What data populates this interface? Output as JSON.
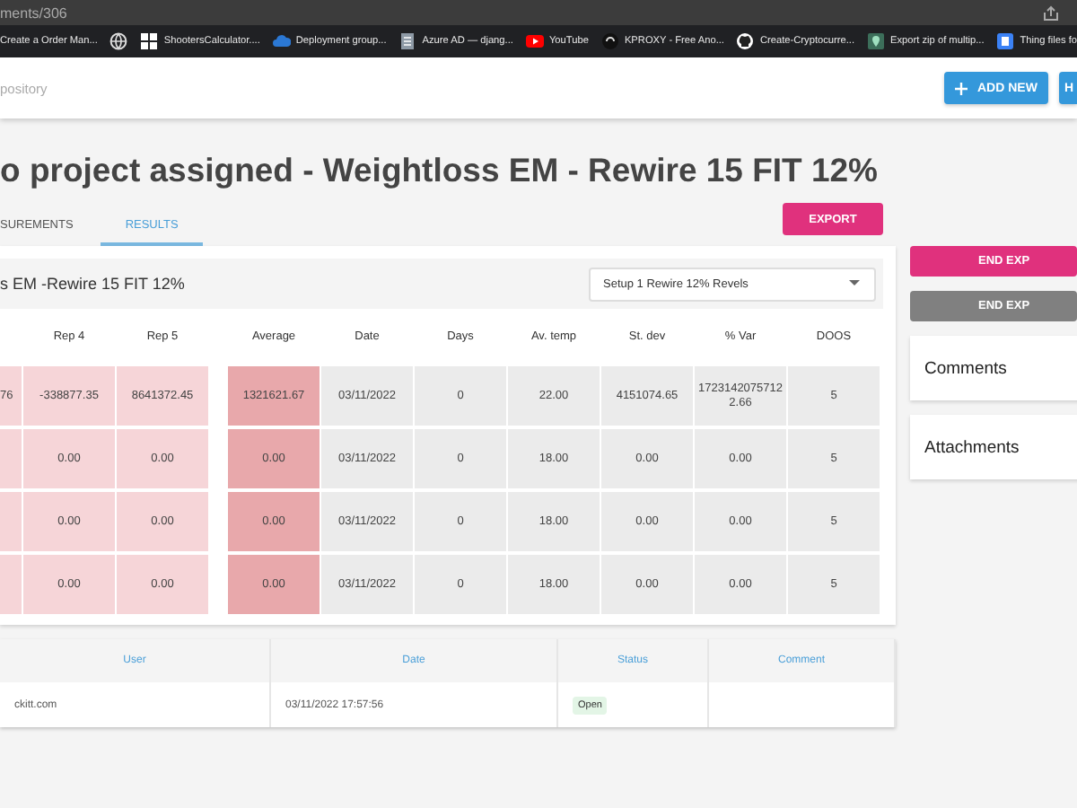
{
  "browser": {
    "url": "ments/306",
    "bookmarks": [
      {
        "kind": "link",
        "label": "Create a Order Man..."
      },
      {
        "kind": "icon_only"
      },
      {
        "kind": "link",
        "label": "ShootersCalculator...."
      },
      {
        "kind": "link",
        "label": "Deployment group..."
      },
      {
        "kind": "link",
        "label": "Azure AD — djang..."
      },
      {
        "kind": "link",
        "label": "YouTube"
      },
      {
        "kind": "link",
        "label": "KPROXY - Free Ano..."
      },
      {
        "kind": "link",
        "label": "Create-Cryptocurre..."
      },
      {
        "kind": "link",
        "label": "Export zip of multip..."
      },
      {
        "kind": "link",
        "label": "Thing files fo"
      }
    ]
  },
  "header": {
    "breadcrumb": "pository",
    "buttons": [
      {
        "label": "ADD NEW"
      },
      {
        "label": "H"
      }
    ]
  },
  "title": "o project assigned - Weightloss EM - Rewire 15 FIT 12%",
  "tabs": [
    {
      "label": "SUREMENTS",
      "selected": false
    },
    {
      "label": "RESULTS",
      "selected": true
    }
  ],
  "export_button": "EXPORT",
  "results": {
    "heading": "s EM -Rewire 15 FIT 12%",
    "setup_select": "Setup 1 Rewire 12% Revels",
    "columns": [
      {
        "label": "Rep 4",
        "kind": "rep"
      },
      {
        "label": "Rep 5",
        "kind": "rep"
      },
      {
        "label": "Average",
        "kind": "average"
      },
      {
        "label": "Date",
        "kind": "info"
      },
      {
        "label": "Days",
        "kind": "info"
      },
      {
        "label": "Av. temp",
        "kind": "info"
      },
      {
        "label": "St. dev",
        "kind": "info"
      },
      {
        "label": "% Var",
        "kind": "info"
      },
      {
        "label": "DOOS",
        "kind": "info"
      }
    ],
    "rows": [
      {
        "column_1": "76",
        "cells": [
          "-338877.35",
          "8641372.45",
          "1321621.67",
          "03/11/2022",
          "0",
          "22.00",
          "4151074.65",
          "17231420757122.66",
          "5"
        ]
      },
      {
        "cells": [
          "0.00",
          "0.00",
          "0.00",
          "03/11/2022",
          "0",
          "18.00",
          "0.00",
          "0.00",
          "5"
        ]
      },
      {
        "cells": [
          "0.00",
          "0.00",
          "0.00",
          "03/11/2022",
          "0",
          "18.00",
          "0.00",
          "0.00",
          "5"
        ]
      },
      {
        "cells": [
          "0.00",
          "0.00",
          "0.00",
          "03/11/2022",
          "0",
          "18.00",
          "0.00",
          "0.00",
          "5"
        ]
      }
    ]
  },
  "history": {
    "columns": [
      "User",
      "Date",
      "Status",
      "Comment"
    ],
    "rows": [
      {
        "user": "ckitt.com",
        "date": "03/11/2022 17:57:56",
        "status": "Open"
      }
    ]
  },
  "side": {
    "buttons": [
      {
        "label": "END EXP",
        "kind": "primary"
      },
      {
        "label": "END EXP",
        "kind": "secondary"
      }
    ],
    "panels": [
      "Comments",
      "Attachments"
    ]
  }
}
